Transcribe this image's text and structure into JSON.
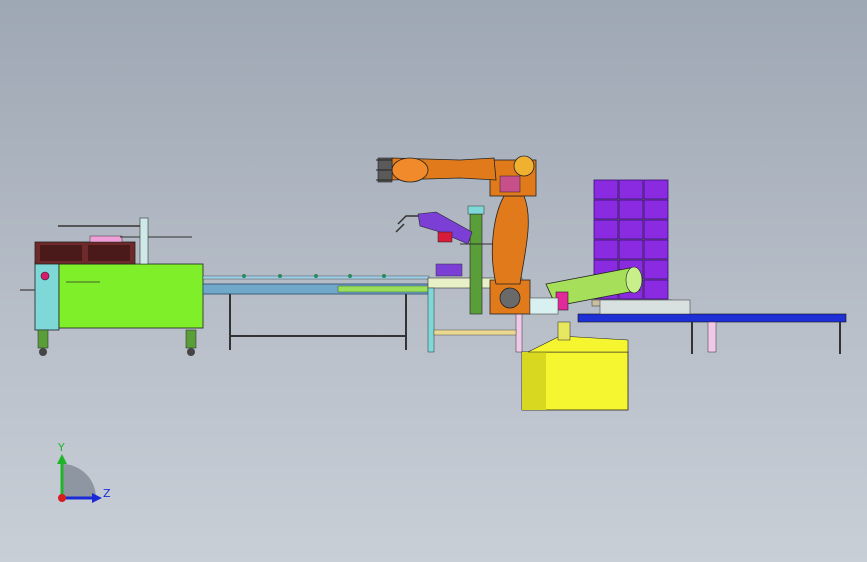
{
  "viewport": {
    "background_top": "#9ea7b4",
    "background_bottom": "#c9cfd7"
  },
  "triad": {
    "y_label": "Y",
    "z_label": "Z",
    "y_color": "#1fb52a",
    "z_color": "#1a2bd6",
    "x_color": "#d81b1b"
  },
  "colors": {
    "packer_body": "#7fef2a",
    "packer_base": "#7fd8d8",
    "packer_top": "#6e2a2a",
    "conveyor": "#6fa8c8",
    "robot": "#e07a1a",
    "robot_accent": "#c8508a",
    "gripper_purple": "#7b3fd6",
    "pallet_stack": "#8a2be2",
    "pallet_conveyor": "#1f2fd6",
    "gantry_green": "#5a9e3a",
    "wrapper_body": "#a6e05a",
    "wrapper_pink": "#e02a9a",
    "yellow_base": "#f5f530"
  },
  "icons": {
    "triad": "axis-triad-icon",
    "robot": "industrial-robot-icon"
  }
}
